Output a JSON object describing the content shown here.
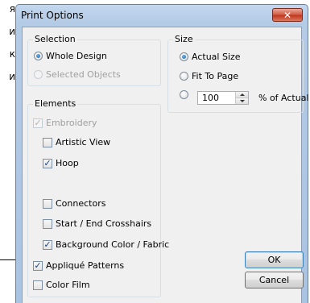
{
  "side_fragments": [
    "я",
    "и",
    "к",
    "и"
  ],
  "dialog": {
    "title": "Print Options",
    "close_glyph": "✕"
  },
  "selection": {
    "label": "Selection",
    "options": [
      {
        "label": "Whole Design",
        "checked": true,
        "enabled": true
      },
      {
        "label": "Selected Objects",
        "checked": false,
        "enabled": false
      }
    ]
  },
  "size": {
    "label": "Size",
    "actual_size": "Actual Size",
    "fit_to_page": "Fit To Page",
    "percent_value": "100",
    "percent_suffix": "% of Actual",
    "selected": "actual_size"
  },
  "elements": {
    "label": "Elements",
    "embroidery": {
      "label": "Embroidery",
      "checked": true,
      "enabled": false
    },
    "artistic_view": {
      "label": "Artistic View",
      "checked": false
    },
    "hoop": {
      "label": "Hoop",
      "checked": true
    },
    "connectors": {
      "label": "Connectors",
      "checked": false
    },
    "crosshairs": {
      "label": "Start / End Crosshairs",
      "checked": false
    },
    "background": {
      "label": "Background Color / Fabric",
      "checked": true
    },
    "applique": {
      "label": "Appliqué Patterns",
      "checked": true
    },
    "color_film": {
      "label": "Color Film",
      "checked": false
    }
  },
  "buttons": {
    "ok": "OK",
    "cancel": "Cancel"
  },
  "check_glyph": "✓"
}
